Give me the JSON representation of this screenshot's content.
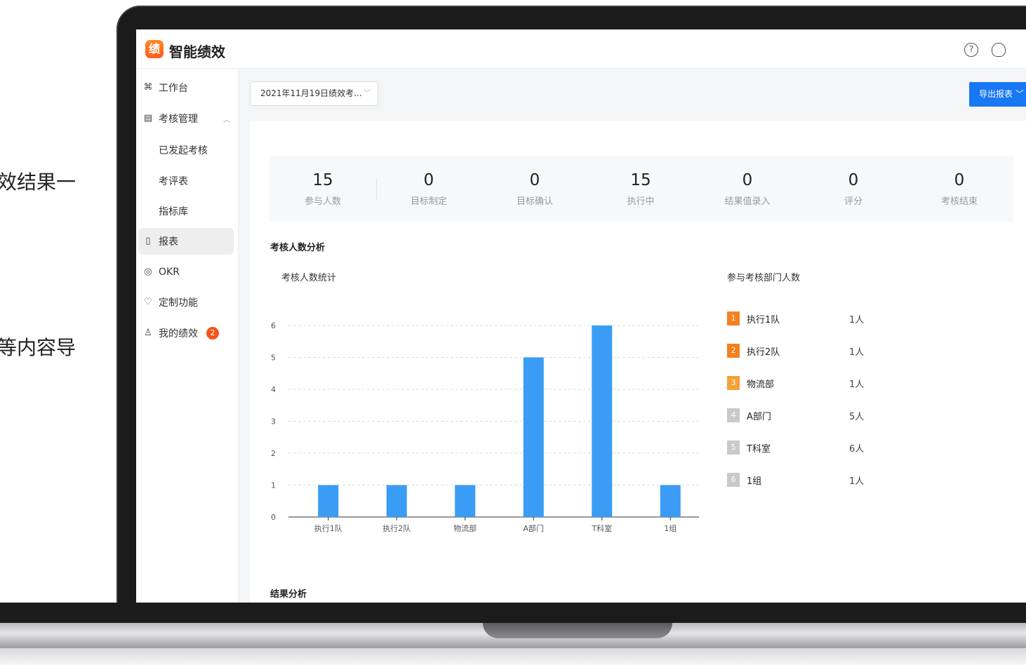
{
  "side_text": {
    "line1": "效结果一",
    "line2": "等内容导"
  },
  "app": {
    "name": "智能绩效",
    "logo_text": "绩"
  },
  "header_icons": [
    "help-icon",
    "bulb-icon"
  ],
  "sidebar": {
    "items": [
      {
        "label": "工作台",
        "icon": "grid-icon",
        "glyph": "⌘"
      },
      {
        "label": "考核管理",
        "icon": "assess-icon",
        "glyph": "▤"
      },
      {
        "label": "已发起考核"
      },
      {
        "label": "考评表"
      },
      {
        "label": "指标库"
      },
      {
        "label": "报表",
        "icon": "report-icon",
        "glyph": "▯"
      },
      {
        "label": "OKR",
        "icon": "okr-icon",
        "glyph": "◎"
      },
      {
        "label": "定制功能",
        "icon": "custom-icon",
        "glyph": "♡"
      },
      {
        "label": "我的绩效",
        "icon": "user-icon",
        "glyph": "♙",
        "badge": "2"
      }
    ]
  },
  "toolbar": {
    "select_value": "2021年11月19日绩效考...",
    "export_label": "导出报表"
  },
  "stats": [
    {
      "value": "15",
      "label": "参与人数"
    },
    {
      "value": "0",
      "label": "目标制定"
    },
    {
      "value": "0",
      "label": "目标确认"
    },
    {
      "value": "15",
      "label": "执行中"
    },
    {
      "value": "0",
      "label": "结果值录入"
    },
    {
      "value": "0",
      "label": "评分"
    },
    {
      "value": "0",
      "label": "考核结束"
    }
  ],
  "sections": {
    "headcount": "考核人数分析",
    "chart_title": "考核人数统计",
    "dept_title": "参与考核部门人数",
    "result": "结果分析"
  },
  "legend": [
    {
      "rank": "1",
      "name": "执行1队",
      "value": "1人",
      "color": "#f5801f"
    },
    {
      "rank": "2",
      "name": "执行2队",
      "value": "1人",
      "color": "#f5801f"
    },
    {
      "rank": "3",
      "name": "物流部",
      "value": "1人",
      "color": "#f5a13a"
    },
    {
      "rank": "4",
      "name": "A部门",
      "value": "5人",
      "color": "#c9c9c9"
    },
    {
      "rank": "5",
      "name": "T科室",
      "value": "6人",
      "color": "#c9c9c9"
    },
    {
      "rank": "6",
      "name": "1组",
      "value": "1人",
      "color": "#c9c9c9"
    }
  ],
  "chart_data": {
    "type": "bar",
    "categories": [
      "执行1队",
      "执行2队",
      "物流部",
      "A部门",
      "T科室",
      "1组"
    ],
    "values": [
      1,
      1,
      1,
      5,
      6,
      1
    ],
    "title": "考核人数统计",
    "ylim": [
      0,
      6
    ],
    "yticks": [
      0,
      1,
      2,
      3,
      4,
      5,
      6
    ],
    "bar_color": "#3a9cf5",
    "grid": true
  }
}
